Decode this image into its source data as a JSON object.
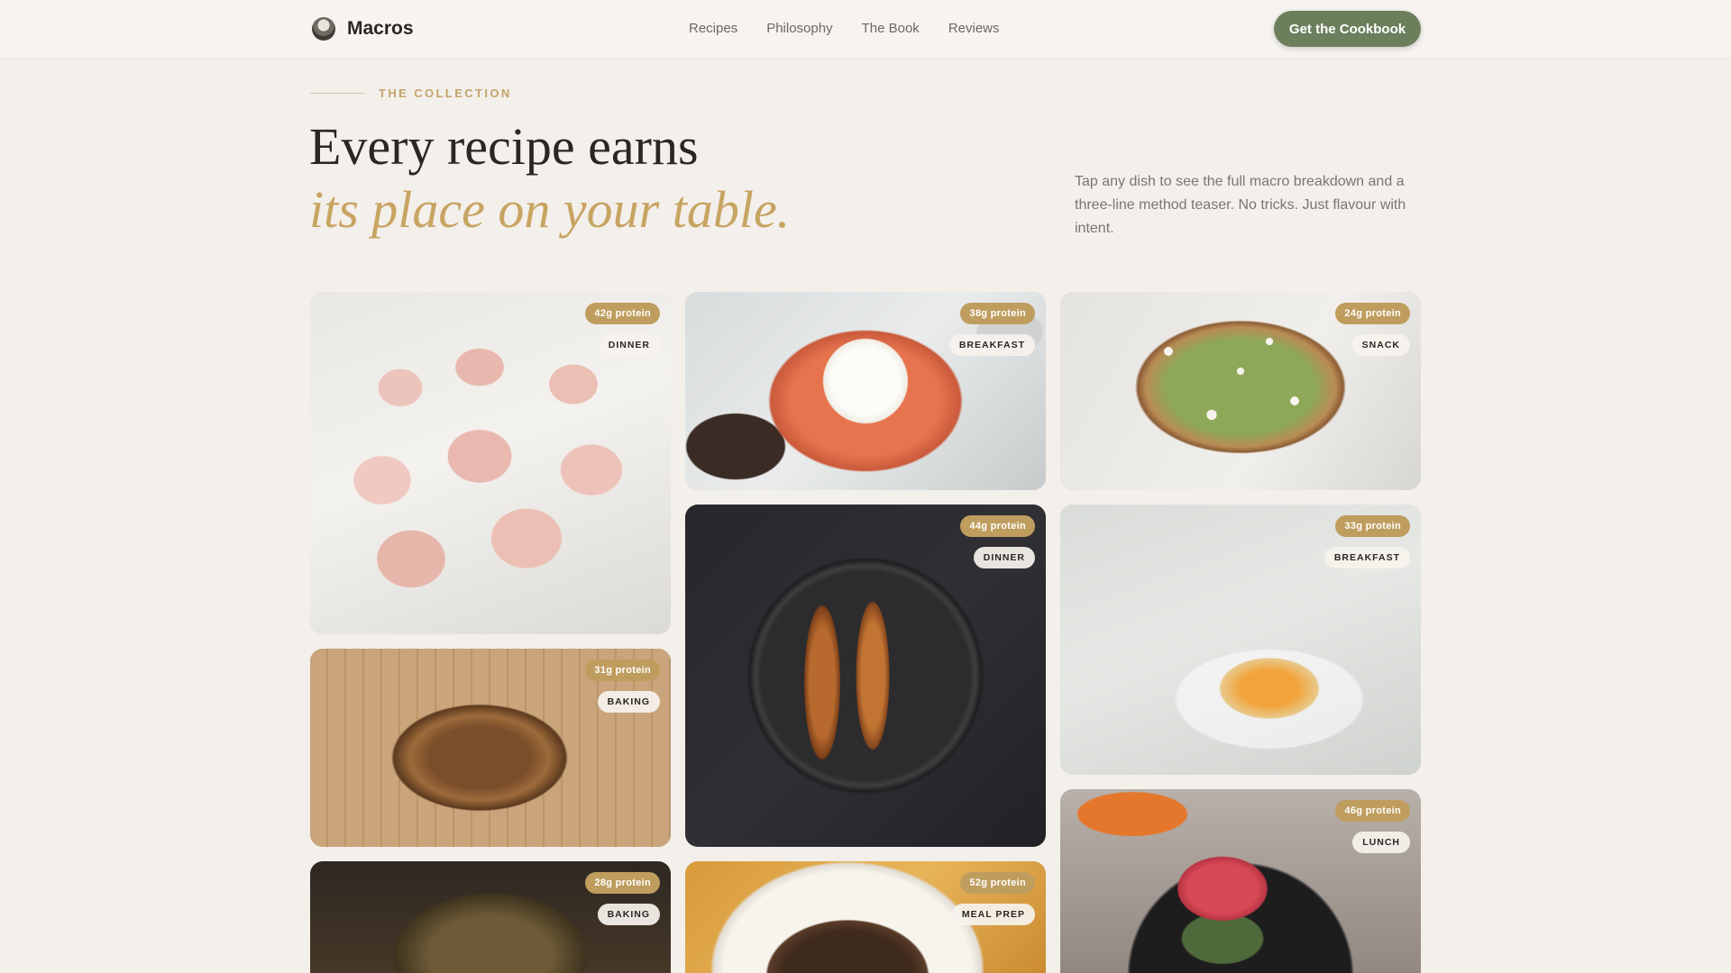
{
  "nav": {
    "brand": "Macros",
    "links": [
      "Recipes",
      "Philosophy",
      "The Book",
      "Reviews"
    ],
    "cta": "Get the Cookbook"
  },
  "hero": {
    "eyebrow": "THE COLLECTION",
    "headline_1": "Every recipe earns",
    "headline_2": "its place on your table.",
    "intro": "Tap any dish to see the full macro breakdown and a three-line method teaser. No tricks. Just flavour with intent."
  },
  "cards": [
    {
      "protein": "42g protein",
      "category": "DINNER"
    },
    {
      "protein": "38g protein",
      "category": "BREAKFAST"
    },
    {
      "protein": "24g protein",
      "category": "SNACK"
    },
    {
      "protein": "44g protein",
      "category": "DINNER"
    },
    {
      "protein": "33g protein",
      "category": "BREAKFAST"
    },
    {
      "protein": "31g protein",
      "category": "BAKING"
    },
    {
      "protein": "46g protein",
      "category": "LUNCH"
    },
    {
      "protein": "28g protein",
      "category": "BAKING"
    },
    {
      "protein": "52g protein",
      "category": "MEAL PREP"
    }
  ],
  "colors": {
    "background": "#f3efeb",
    "accent_gold": "#c8a462",
    "cta_green": "#6c7f5c"
  }
}
